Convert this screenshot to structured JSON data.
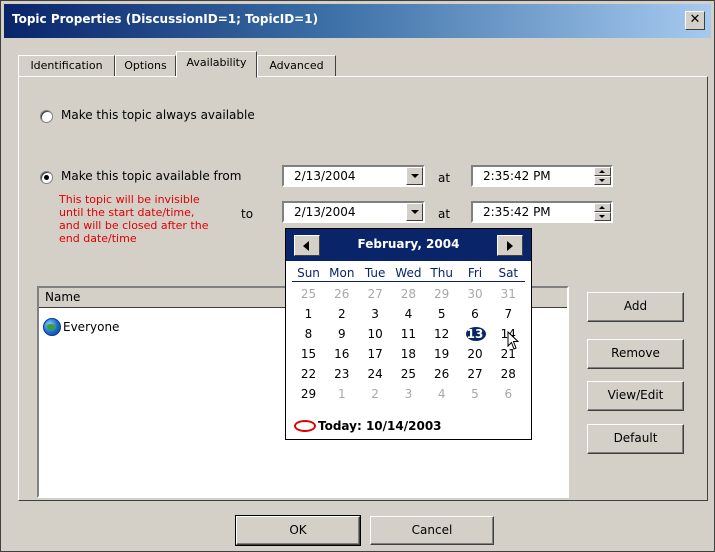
{
  "window": {
    "title": "Topic Properties (DiscussionID=1; TopicID=1)",
    "close_glyph": "✕"
  },
  "tabs": [
    {
      "label": "Identification",
      "active": false
    },
    {
      "label": "Options",
      "active": false
    },
    {
      "label": "Availability",
      "active": true
    },
    {
      "label": "Advanced",
      "active": false
    }
  ],
  "availability": {
    "always_label": "Make this topic always available",
    "from_label": "Make this topic available from",
    "to_label": "to",
    "at_label": "at",
    "note": "This topic will be invisible\nuntil the start date/time,\nand will be closed after the\nend date/time",
    "from_date": "2/13/2004",
    "from_time": "2:35:42 PM",
    "to_date": "2/13/2004",
    "to_time": "2:35:42 PM",
    "selected_option": "from"
  },
  "list": {
    "column_name": "Name",
    "items": [
      {
        "name": "Everyone",
        "icon": "globe-icon"
      }
    ]
  },
  "side_buttons": {
    "add": "Add",
    "remove": "Remove",
    "view_edit": "View/Edit",
    "default": "Default"
  },
  "footer": {
    "ok": "OK",
    "cancel": "Cancel"
  },
  "calendar": {
    "month_title": "February, 2004",
    "days_of_week": [
      "Sun",
      "Mon",
      "Tue",
      "Wed",
      "Thu",
      "Fri",
      "Sat"
    ],
    "weeks": [
      [
        {
          "d": "25",
          "o": true
        },
        {
          "d": "26",
          "o": true
        },
        {
          "d": "27",
          "o": true
        },
        {
          "d": "28",
          "o": true
        },
        {
          "d": "29",
          "o": true
        },
        {
          "d": "30",
          "o": true
        },
        {
          "d": "31",
          "o": true
        }
      ],
      [
        {
          "d": "1"
        },
        {
          "d": "2"
        },
        {
          "d": "3"
        },
        {
          "d": "4"
        },
        {
          "d": "5"
        },
        {
          "d": "6"
        },
        {
          "d": "7"
        }
      ],
      [
        {
          "d": "8"
        },
        {
          "d": "9"
        },
        {
          "d": "10"
        },
        {
          "d": "11"
        },
        {
          "d": "12"
        },
        {
          "d": "13",
          "sel": true
        },
        {
          "d": "14"
        }
      ],
      [
        {
          "d": "15"
        },
        {
          "d": "16"
        },
        {
          "d": "17"
        },
        {
          "d": "18"
        },
        {
          "d": "19"
        },
        {
          "d": "20"
        },
        {
          "d": "21"
        }
      ],
      [
        {
          "d": "22"
        },
        {
          "d": "23"
        },
        {
          "d": "24"
        },
        {
          "d": "25"
        },
        {
          "d": "26"
        },
        {
          "d": "27"
        },
        {
          "d": "28"
        }
      ],
      [
        {
          "d": "29"
        },
        {
          "d": "1",
          "o": true
        },
        {
          "d": "2",
          "o": true
        },
        {
          "d": "3",
          "o": true
        },
        {
          "d": "4",
          "o": true
        },
        {
          "d": "5",
          "o": true
        },
        {
          "d": "6",
          "o": true
        }
      ]
    ],
    "today_label": "Today: 10/14/2003"
  }
}
